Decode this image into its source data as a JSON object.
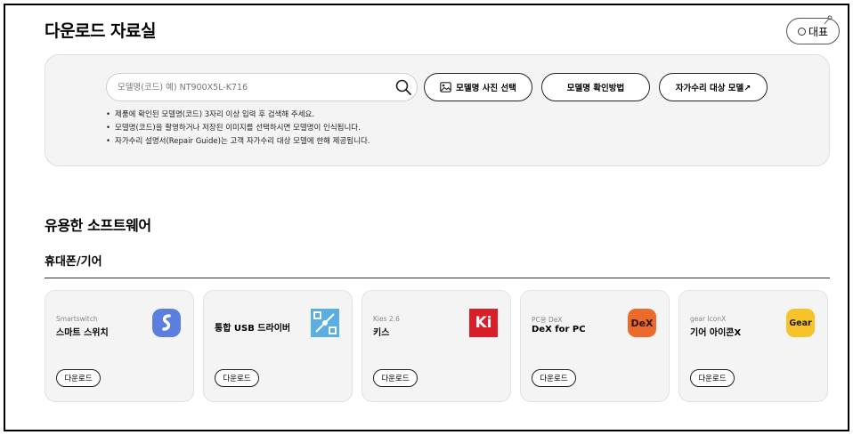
{
  "page": {
    "title": "다운로드 자료실"
  },
  "header": {
    "representative_label": "대표"
  },
  "search": {
    "placeholder": "모델명(코드) 예) NT900X5L-K716",
    "photo_select_label": "모델명 사진 선택",
    "how_to_check_label": "모델명 확인방법",
    "self_repair_label": "자가수리 대상 모델↗"
  },
  "notes": [
    "제품에 확인된 모델명(코드) 3자리 이상 입력 후 검색해 주세요.",
    "모델명(코드)을 촬영하거나 저장된 이미지를 선택하시면 모델명이 인식됩니다.",
    "자가수리 설명서(Repair Guide)는 고객 자가수리 대상 모델에 한해 제공됩니다."
  ],
  "software": {
    "section_title": "유용한 소프트웨어",
    "category_title": "휴대폰/기어",
    "cards": [
      {
        "category": "Smartswitch",
        "name": "스마트 스위치",
        "download_label": "다운로드",
        "icon": "smartswitch-icon",
        "color": "#5b7fde"
      },
      {
        "category": "",
        "name": "통합 USB 드라이버",
        "download_label": "다운로드",
        "icon": "usb-driver-icon",
        "color": "#5aaee4"
      },
      {
        "category": "Kies 2.6",
        "name": "키스",
        "download_label": "다운로드",
        "icon": "kies-icon",
        "color": "#d91e2a"
      },
      {
        "category": "PC용 DeX",
        "name": "DeX for PC",
        "download_label": "다운로드",
        "icon": "dex-icon",
        "color": "#ec6a2c"
      },
      {
        "category": "gear IconX",
        "name": "기어 아이콘X",
        "download_label": "다운로드",
        "icon": "gear-icon",
        "color": "#f6c32b"
      }
    ]
  },
  "logos": {
    "kies": "Ki",
    "dex": "DeX",
    "gear": "Gear"
  }
}
